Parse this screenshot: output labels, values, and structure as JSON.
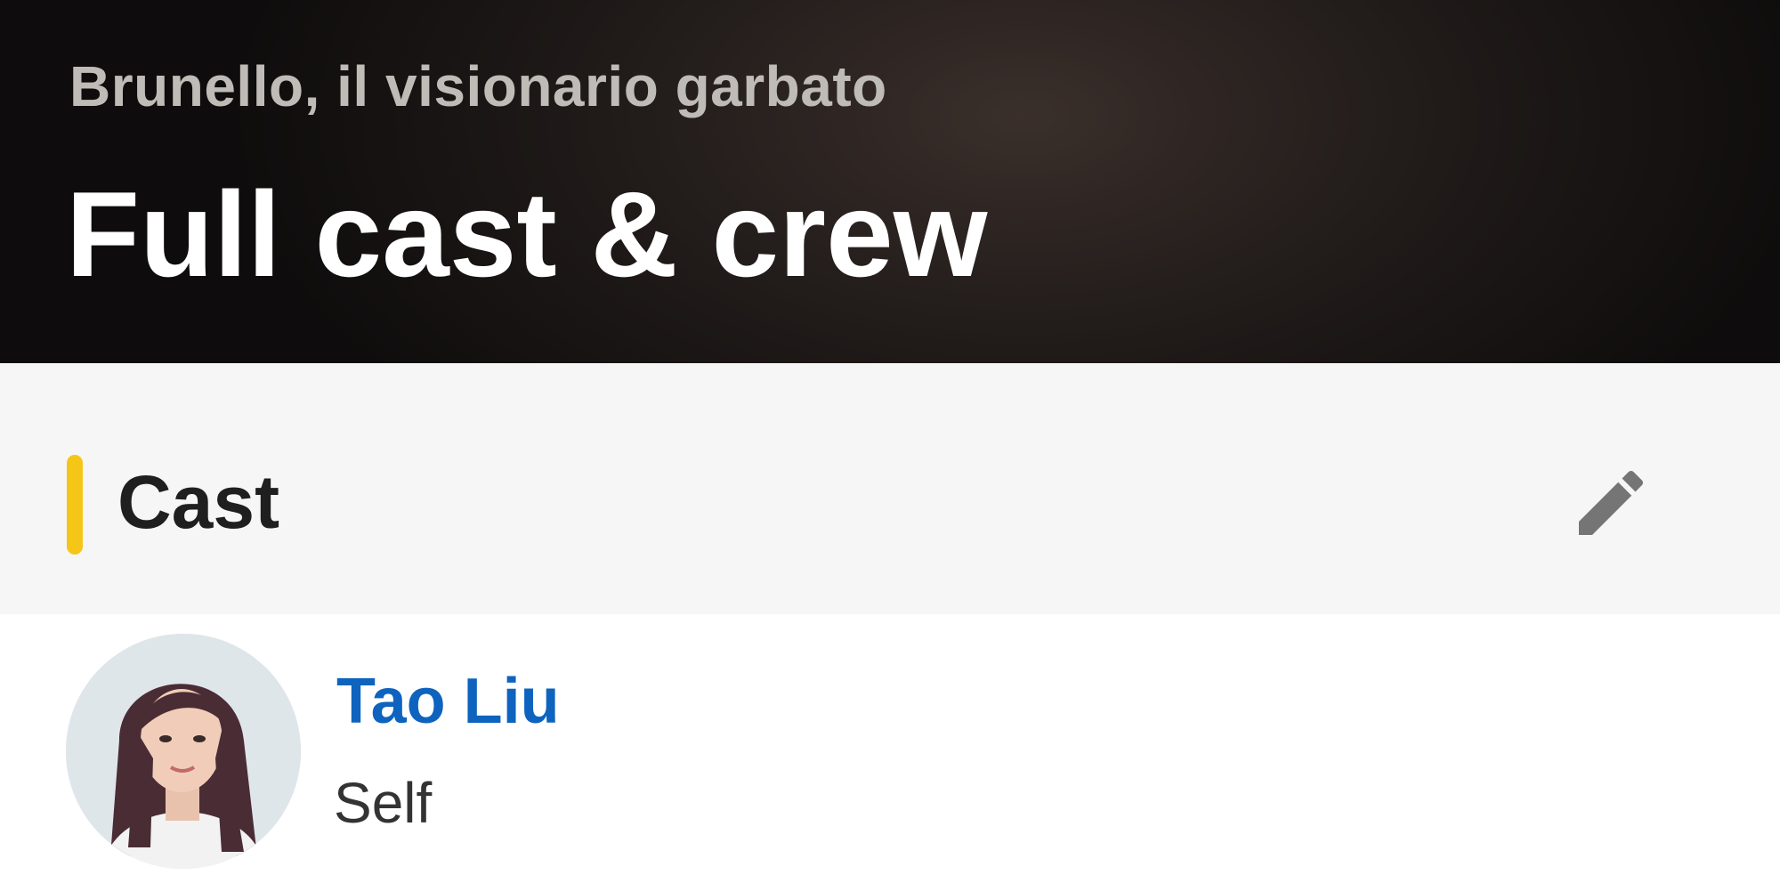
{
  "header": {
    "subtitle": "Brunello, il visionario garbato",
    "title": "Full cast & crew"
  },
  "section": {
    "title": "Cast",
    "accent_color": "#f5c518",
    "edit_icon": "pencil-icon"
  },
  "cast": [
    {
      "name": "Tao Liu",
      "role": "Self",
      "name_color": "#0e63be"
    }
  ]
}
